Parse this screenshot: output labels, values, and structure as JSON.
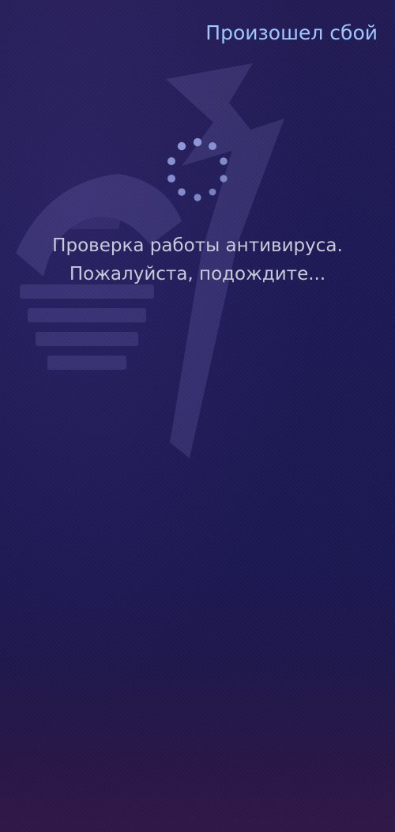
{
  "header": {
    "error_link": "Произошел сбой"
  },
  "status": {
    "line1": "Проверка работы антивируса.",
    "line2": "Пожалуйста, подождите..."
  },
  "icons": {
    "loading": "loading-spinner-icon",
    "background": "shield-spider-logo-watermark"
  },
  "colors": {
    "background": "#1d1a56",
    "link": "#9fc7ff",
    "text": "#c9cad8",
    "spinner": "#8b97d8"
  }
}
